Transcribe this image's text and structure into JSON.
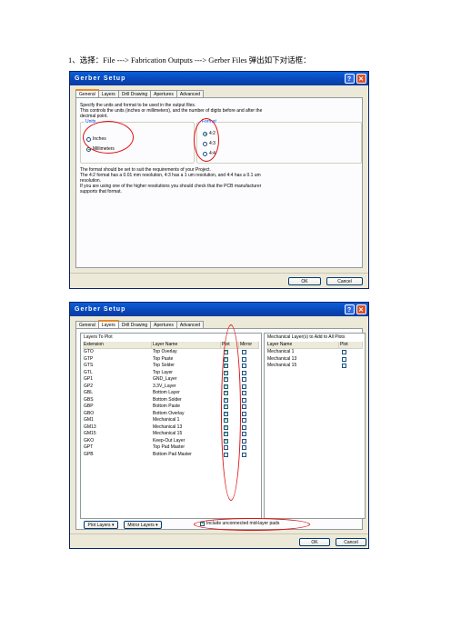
{
  "doc_text": "1、选择：File ---> Fabrication Outputs ---> Gerber Files 弹出如下对话框：",
  "dialog1": {
    "title": "Gerber  Setup",
    "tabs": [
      "General",
      "Layers",
      "Drill Drawing",
      "Apertures",
      "Advanced"
    ],
    "intro": "Specify the units and format to be used in the output files.\nThis controls the units (inches or millimeters), and the number of digits before and after the\ndecimal point.",
    "units_label": "Units",
    "units_options": [
      "Inches",
      "Millimeters"
    ],
    "units_selected": "Millimeters",
    "format_label": "Format",
    "format_options": [
      "4:2",
      "4:3",
      "4:4"
    ],
    "format_selected": "4:2",
    "format_note": "The format should be set to suit the requirements of your Project.\nThe 4:2 format has a 0.01 mm resolution, 4:3 has a 1 um resolution, and 4:4 has a 0.1 um\nresolution.\nIf you are using one of the higher resolutions you should check that the PCB manufacturer\nsupports that format.",
    "ok": "OK",
    "cancel": "Cancel"
  },
  "dialog2": {
    "title": "Gerber  Setup",
    "tabs": [
      "General",
      "Layers",
      "Drill Drawing",
      "Apertures",
      "Advanced"
    ],
    "layers_to_plot": "Layers To Plot",
    "columns": [
      "Extension",
      "Layer Name",
      "Plot",
      "Mirror"
    ],
    "rows": [
      {
        "ext": "GTO",
        "name": "Top Overlay",
        "plot": true
      },
      {
        "ext": "GTP",
        "name": "Top Paste",
        "plot": true
      },
      {
        "ext": "GTS",
        "name": "Top Solder",
        "plot": true
      },
      {
        "ext": "GTL",
        "name": "Top Layer",
        "plot": true
      },
      {
        "ext": "GP1",
        "name": "GND_Layer",
        "plot": true
      },
      {
        "ext": "GP2",
        "name": "3.3V_Layer",
        "plot": true
      },
      {
        "ext": "GBL",
        "name": "Bottom Layer",
        "plot": true
      },
      {
        "ext": "GBS",
        "name": "Bottom Solder",
        "plot": true
      },
      {
        "ext": "GBP",
        "name": "Bottom Paste",
        "plot": true
      },
      {
        "ext": "GBO",
        "name": "Bottom Overlay",
        "plot": true
      },
      {
        "ext": "GM1",
        "name": "Mechanical 1",
        "plot": true
      },
      {
        "ext": "GM13",
        "name": "Mechanical 13",
        "plot": true
      },
      {
        "ext": "GM15",
        "name": "Mechanical 15",
        "plot": true
      },
      {
        "ext": "GKO",
        "name": "Keep-Out Layer",
        "plot": true
      },
      {
        "ext": "GPT",
        "name": "Top Pad Master",
        "plot": false
      },
      {
        "ext": "GPB",
        "name": "Bottom Pad Master",
        "plot": false
      }
    ],
    "mech_title": "Mechanical Layer(s) to Add to All Plots",
    "mech_columns": [
      "Layer Name",
      "Plot"
    ],
    "mech_rows": [
      "Mechanical 1",
      "Mechanical 13",
      "Mechanical 15"
    ],
    "plot_layers_btn": "Plot Layers",
    "mirror_layers_btn": "Mirror Layers",
    "include_unconnected": "Include unconnected mid-layer pads",
    "ok": "OK",
    "cancel": "Cancel"
  }
}
